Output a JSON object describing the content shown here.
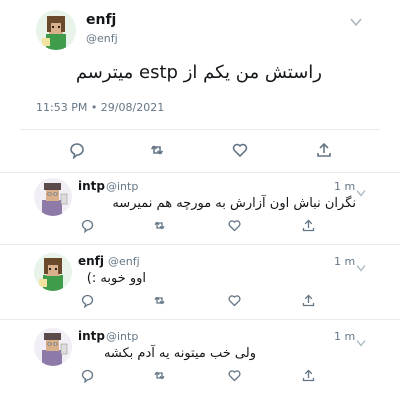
{
  "main_tweet": {
    "name": "enfj",
    "handle": "@enfj",
    "text": "راستش من یکم از estp میترسم",
    "timestamp": "11:53 PM • 29/08/2021",
    "actions": [
      "reply-icon",
      "retweet-icon",
      "like-icon",
      "share-icon"
    ]
  },
  "replies": [
    {
      "name": "intp",
      "handle": "@intp",
      "time": "1 m",
      "text": "نگران نباش اون آزارش به مورچه هم نمیرسه",
      "avatar": "intp"
    },
    {
      "name": "enfj",
      "handle": "@enfj",
      "time": "1 m",
      "text": "اوو خوبه :)",
      "avatar": "enfj"
    },
    {
      "name": "intp",
      "handle": "@intp",
      "time": "1 m",
      "text": "ولی خب میتونه یه آدم بکشه",
      "avatar": "intp"
    }
  ],
  "colors": {
    "icon": "#657786",
    "text": "#14171a",
    "secondary": "#657786",
    "divider": "#e6ecf0"
  }
}
